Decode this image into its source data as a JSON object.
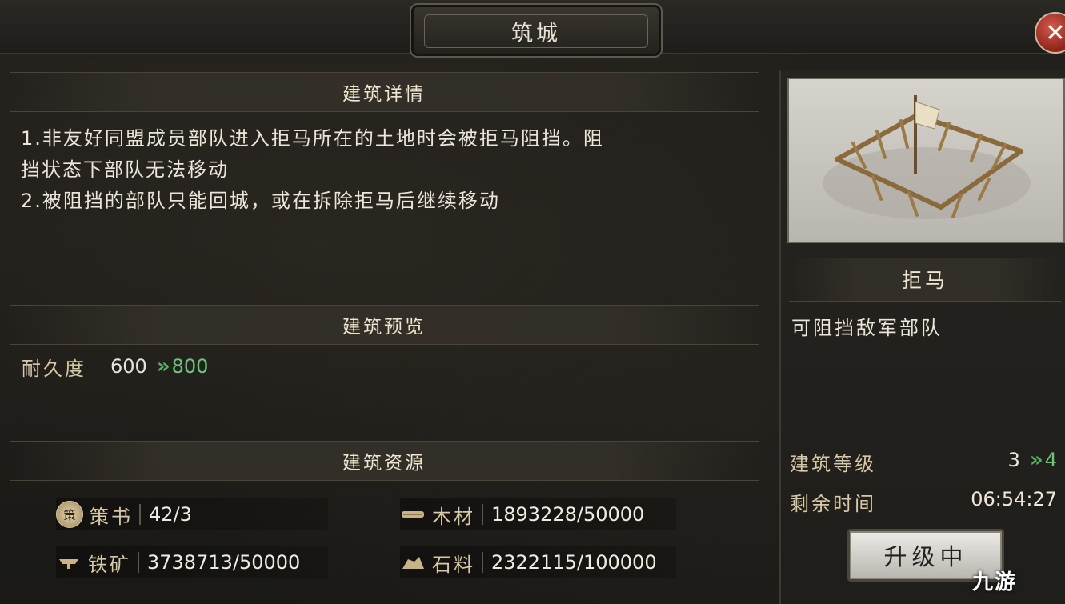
{
  "window": {
    "title": "筑城",
    "close_glyph": "✕"
  },
  "details": {
    "heading": "建筑详情",
    "lines": [
      "1.非友好同盟成员部队进入拒马所在的土地时会被拒马阻挡。阻",
      "挡状态下部队无法移动",
      "2.被阻挡的部队只能回城，或在拆除拒马后继续移动"
    ]
  },
  "preview_section": {
    "heading": "建筑预览",
    "durability_label": "耐久度",
    "durability_current": "600",
    "durability_next": "800"
  },
  "resources": {
    "heading": "建筑资源",
    "items": [
      {
        "icon_name": "scroll-icon",
        "icon_glyph": "策",
        "name": "策书",
        "value": "42/3"
      },
      {
        "icon_name": "wood-icon",
        "icon_glyph": "",
        "name": "木材",
        "value": "1893228/50000"
      },
      {
        "icon_name": "iron-icon",
        "icon_glyph": "",
        "name": "铁矿",
        "value": "3738713/50000"
      },
      {
        "icon_name": "stone-icon",
        "icon_glyph": "",
        "name": "石料",
        "value": "2322115/100000"
      }
    ]
  },
  "building": {
    "name": "拒马",
    "description": "可阻挡敌军部队",
    "level_label": "建筑等级",
    "level_current": "3",
    "level_next": "4",
    "time_label": "剩余时间",
    "time_value": "06:54:27",
    "upgrade_button": "升级中"
  },
  "watermark": "九游",
  "colors": {
    "accent_green": "#6dc47b",
    "label_gold": "#d8c9a4",
    "close_red": "#b23a2d"
  }
}
